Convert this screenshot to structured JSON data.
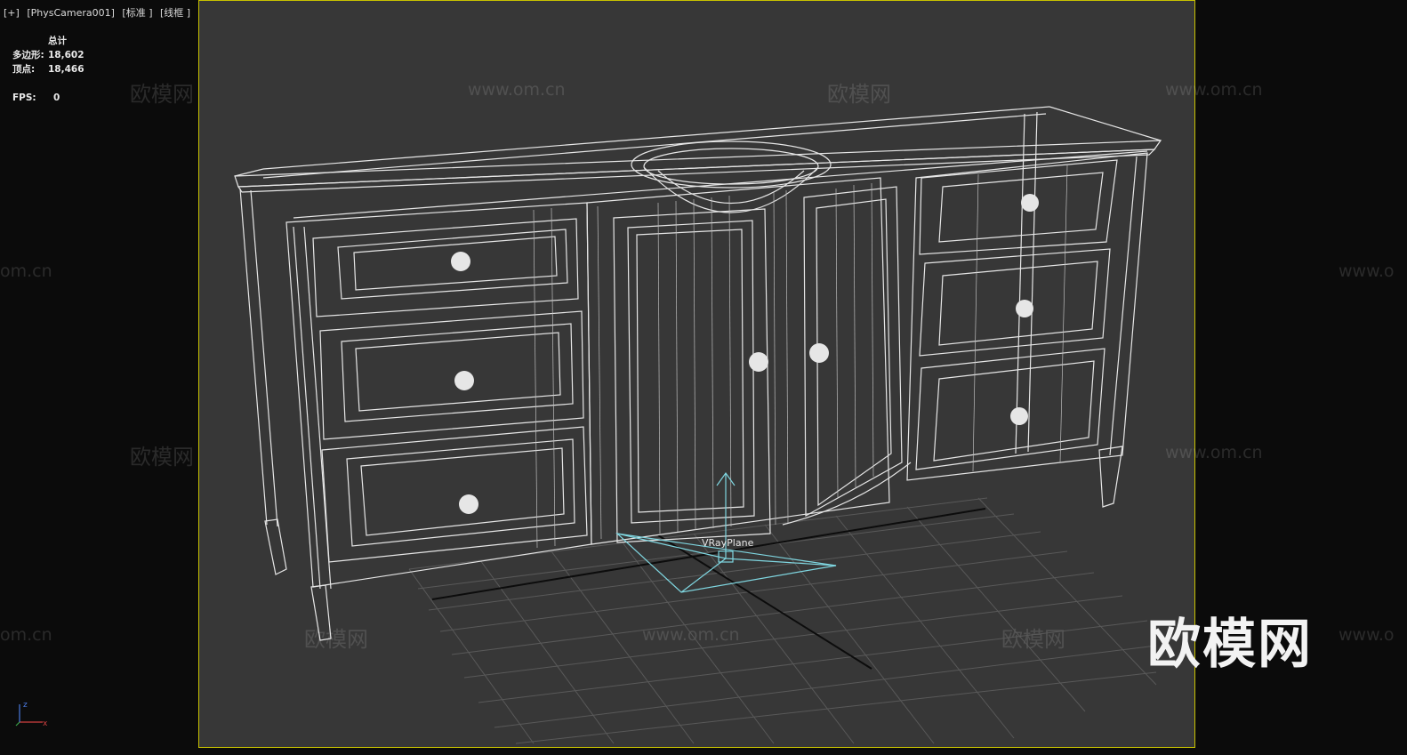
{
  "viewport": {
    "label_parts": [
      "[+]",
      "[PhysCamera001]",
      "[标准 ]",
      "[线框 ]"
    ]
  },
  "stats": {
    "header": "总计",
    "polygons_label": "多边形:",
    "polygons_value": "18,602",
    "vertices_label": "顶点:",
    "vertices_value": "18,466",
    "fps_label": "FPS:",
    "fps_value": "0"
  },
  "scene": {
    "object_label": "VRayPlane",
    "wire_color": "#e6e6e6",
    "grid_color": "#5a5a5a",
    "light_color": "#7fd6e0",
    "frame_color": "#c8c200"
  },
  "watermarks": {
    "brand_text": "欧模网",
    "site_text": "www.om.cn",
    "partial_site": "om.cn",
    "partial_www": "www.o"
  },
  "brand_logo": "欧模网",
  "axis": {
    "x": "x",
    "z": "z"
  }
}
